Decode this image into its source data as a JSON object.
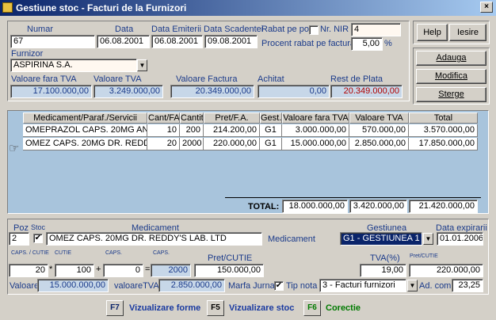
{
  "window": {
    "title": "Gestiune stoc - Facturi de la Furnizori"
  },
  "header": {
    "numar_label": "Numar",
    "numar": "67",
    "data_label": "Data",
    "data": "06.08.2001",
    "data_emiterii_label": "Data Emiterii",
    "data_emiterii": "06.08.2001",
    "data_scadentei_label": "Data Scadentei",
    "data_scadentei": "09.08.2001",
    "rabat_label": "Rabat pe poz",
    "nr_nir_label": "Nr. NIR",
    "nr_nir": "4",
    "procent_label": "Procent rabat pe factura",
    "procent": "5,00",
    "procent_unit": "%",
    "furnizor_label": "Furnizor",
    "furnizor": "ASPIRINA S.A.",
    "val_fara_tva_label": "Valoare fara TVA",
    "val_fara_tva": "17.100.000,00",
    "val_tva_label": "Valoare TVA",
    "val_tva": "3.249.000,00",
    "val_factura_label": "Valoare Factura",
    "val_factura": "20.349.000,00",
    "achitat_label": "Achitat",
    "achitat": "0,00",
    "rest_label": "Rest de Plata",
    "rest": "20.349.000,00"
  },
  "buttons": {
    "help": "Help",
    "iesire": "Iesire",
    "adauga": "Adauga",
    "modifica": "Modifica",
    "sterge": "Sterge"
  },
  "table": {
    "columns": [
      "Medicament/Paraf./Servicii",
      "Cant/FA",
      "Cantit.",
      "Pret/F.A.",
      "Gest.",
      "Valoare fara TVA",
      "Valoare TVA",
      "Total"
    ],
    "rows": [
      [
        "OMEPRAZOL CAPS. 20MG ANTI",
        "10",
        "200",
        "214.200,00",
        "G1",
        "3.000.000,00",
        "570.000,00",
        "3.570.000,00"
      ],
      [
        "OMEZ CAPS. 20MG DR. REDDY",
        "20",
        "2000",
        "220.000,00",
        "G1",
        "15.000.000,00",
        "2.850.000,00",
        "17.850.000,00"
      ]
    ],
    "total_label": "TOTAL:",
    "total_fara_tva": "18.000.000,00",
    "total_tva": "3.420.000,00",
    "total": "21.420.000,00"
  },
  "detail": {
    "poz_label": "Poz",
    "poz": "2",
    "stoc_label": "Stoc",
    "medicament_label": "Medicament",
    "medicament": "OMEZ CAPS. 20MG DR. REDDY'S LAB. LTD",
    "medicament_side_label": "Medicament",
    "gestiunea_label": "Gestiunea",
    "gestiunea": "G1 - GESTIUNEA 1",
    "expirare_label": "Data expirarii",
    "expirare": "01.01.2006",
    "caps_cutie_label": "CAPS. / CUTIE",
    "caps_cutie": "20",
    "cutie_label": "CUTIE",
    "cutie": "100",
    "caps_label": "CAPS.",
    "caps": "0",
    "caps2_label": "CAPS.",
    "caps2": "2000",
    "pret_cutie_label": "Pret/CUTIE",
    "pret_cutie": "150.000,00",
    "tva_label": "TVA(%)",
    "tva": "19,00",
    "pret_cutie2_label": "Pret/CUTIE",
    "pret_cutie2": "220.000,00",
    "valoare_label": "Valoare:",
    "valoare": "15.000.000,00",
    "valoare_tva_label": "valoareTVA",
    "valoare_tva": "2.850.000,00",
    "marfa_label": "Marfa Jurnal",
    "tip_nota_label": "Tip nota",
    "tip_nota": "3 - Facturi furnizori",
    "ad_com_label": "Ad. com.",
    "ad_com": "23,25",
    "op_star": "*",
    "op_plus": "+",
    "op_eq": "="
  },
  "footer": {
    "f7_key": "F7",
    "f7_label": "Vizualizare forme",
    "f5_key": "F5",
    "f5_label": "Vizualizare stoc",
    "f6_key": "F6",
    "f6_label": "Corectie"
  },
  "colors": {
    "accent": "#0a246a",
    "grid": "#a8c4dc",
    "ro_field": "#c7d7e8",
    "red": "#b00000",
    "green": "#007a00"
  }
}
